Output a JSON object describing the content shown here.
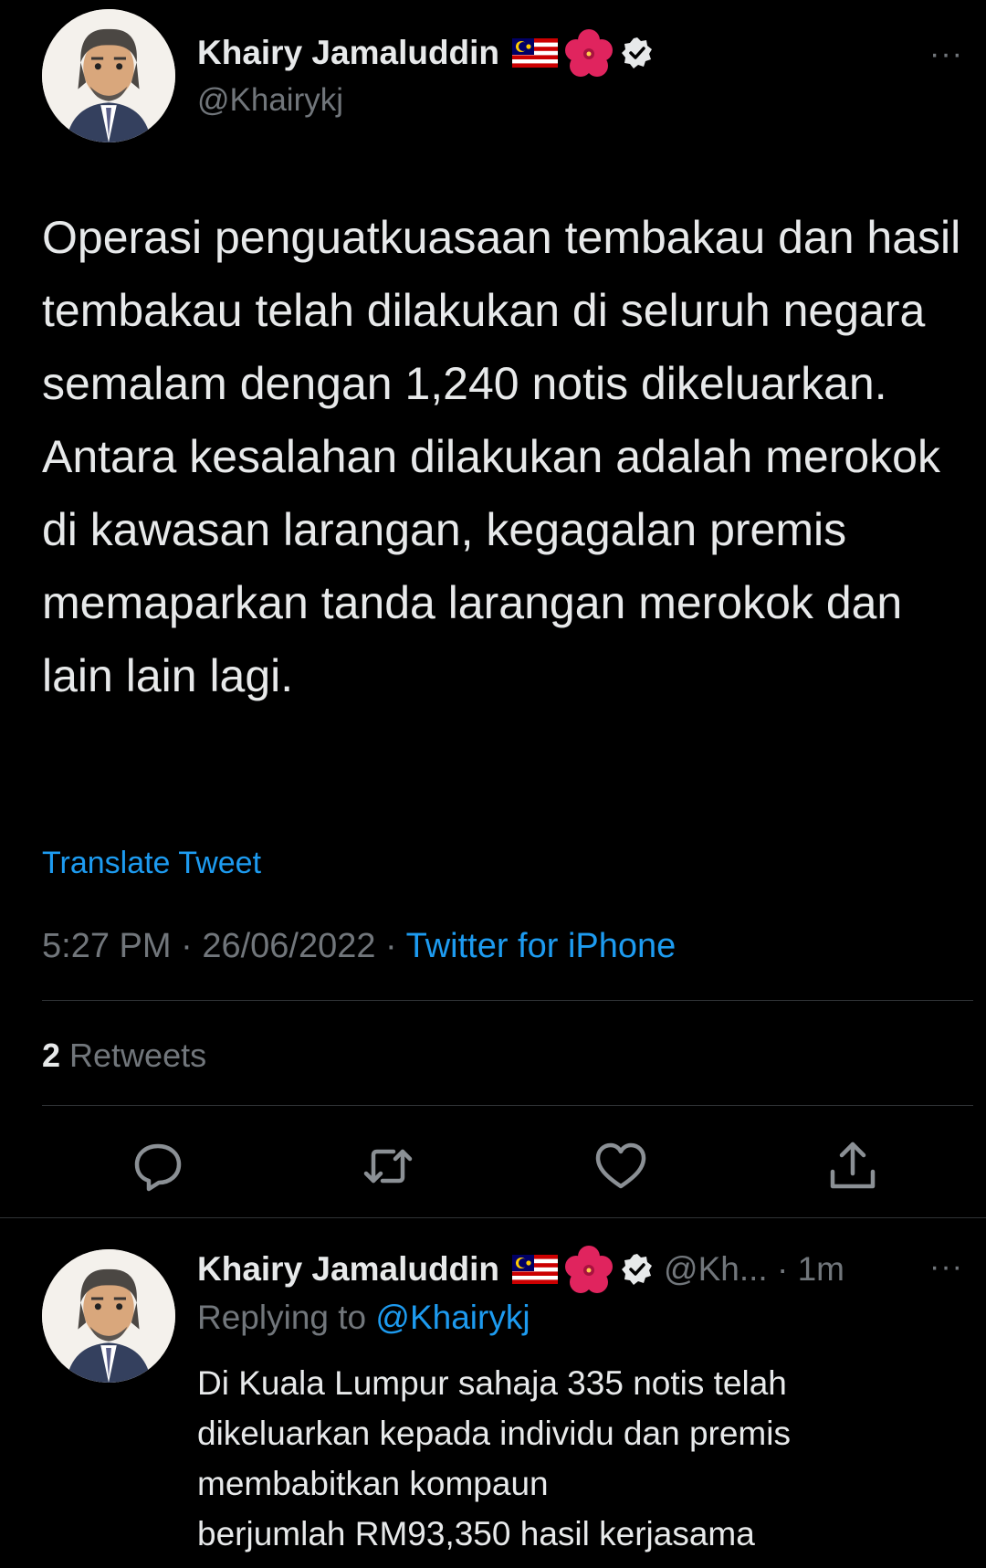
{
  "main_tweet": {
    "author_name": "Khairy Jamaluddin",
    "handle": "@Khairykj",
    "text": "Operasi penguatkuasaan tembakau dan hasil tembakau telah dilakukan di seluruh negara semalam dengan 1,240 notis dikeluarkan. Antara kesalahan dilakukan adalah merokok di kawasan larangan, kegagalan premis memaparkan tanda larangan merokok dan lain lain lagi.",
    "translate_label": "Translate Tweet",
    "time": "5:27 PM",
    "date": "26/06/2022",
    "separator": " · ",
    "source": "Twitter for iPhone",
    "retweet_count": "2",
    "retweet_label": " Retweets",
    "more_label": "···"
  },
  "actions": {
    "reply": "reply-icon",
    "retweet": "retweet-icon",
    "like": "heart-icon",
    "share": "share-icon"
  },
  "reply_tweet": {
    "author_name": "Khairy Jamaluddin",
    "meta": "@Kh... · 1m",
    "replying_prefix": "Replying to ",
    "replying_to": "@Khairykj",
    "text": "Di Kuala Lumpur sahaja 335 notis telah dikeluarkan kepada individu dan premis membabitkan kompaun\nberjumlah RM93,350 hasil kerjasama",
    "more_label": "···"
  },
  "colors": {
    "background": "#000000",
    "primary_text": "#e7e9ea",
    "secondary_text": "#71767b",
    "accent": "#1d9bf0",
    "divider": "#2f3336"
  }
}
